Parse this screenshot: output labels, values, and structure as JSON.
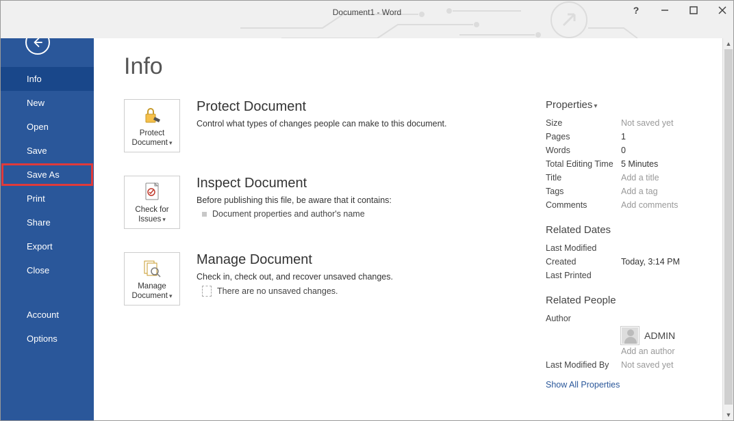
{
  "window": {
    "title": "Document1 - Word"
  },
  "sidebar": {
    "items": [
      {
        "label": "Info",
        "active": true
      },
      {
        "label": "New"
      },
      {
        "label": "Open"
      },
      {
        "label": "Save"
      },
      {
        "label": "Save As",
        "highlight": true
      },
      {
        "label": "Print"
      },
      {
        "label": "Share"
      },
      {
        "label": "Export"
      },
      {
        "label": "Close"
      }
    ],
    "footer": [
      {
        "label": "Account"
      },
      {
        "label": "Options"
      }
    ]
  },
  "page": {
    "title": "Info"
  },
  "sections": {
    "protect": {
      "tile_label": "Protect Document",
      "title": "Protect Document",
      "desc": "Control what types of changes people can make to this document."
    },
    "inspect": {
      "tile_label": "Check for Issues",
      "title": "Inspect Document",
      "desc": "Before publishing this file, be aware that it contains:",
      "bullet": "Document properties and author's name"
    },
    "manage": {
      "tile_label": "Manage Document",
      "title": "Manage Document",
      "desc": "Check in, check out, and recover unsaved changes.",
      "note": "There are no unsaved changes."
    }
  },
  "properties": {
    "header": "Properties",
    "rows": [
      {
        "label": "Size",
        "value": "Not saved yet",
        "muted": true
      },
      {
        "label": "Pages",
        "value": "1"
      },
      {
        "label": "Words",
        "value": "0"
      },
      {
        "label": "Total Editing Time",
        "value": "5 Minutes"
      },
      {
        "label": "Title",
        "value": "Add a title",
        "muted": true
      },
      {
        "label": "Tags",
        "value": "Add a tag",
        "muted": true
      },
      {
        "label": "Comments",
        "value": "Add comments",
        "muted": true
      }
    ],
    "related_dates": {
      "header": "Related Dates",
      "rows": [
        {
          "label": "Last Modified",
          "value": ""
        },
        {
          "label": "Created",
          "value": "Today, 3:14 PM"
        },
        {
          "label": "Last Printed",
          "value": ""
        }
      ]
    },
    "related_people": {
      "header": "Related People",
      "author_label": "Author",
      "author_name": "ADMIN",
      "add_author": "Add an author",
      "last_modified_by_label": "Last Modified By",
      "last_modified_by_value": "Not saved yet"
    },
    "show_all": "Show All Properties"
  }
}
